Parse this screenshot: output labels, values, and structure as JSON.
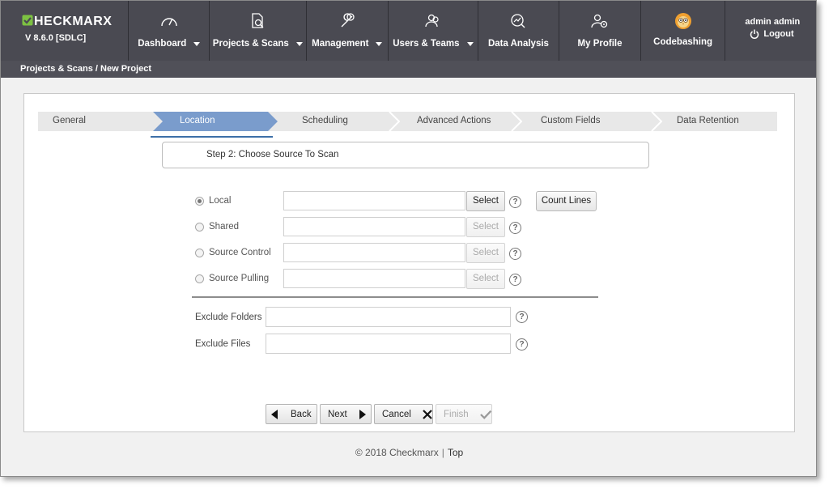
{
  "app": {
    "brand": "CHECKMARX",
    "version": "V 8.6.0  [SDLC]"
  },
  "nav": {
    "items": [
      {
        "label": "Dashboard",
        "icon": "gauge-icon",
        "dropdown": true
      },
      {
        "label": "Projects & Scans",
        "icon": "document-search-icon",
        "dropdown": true
      },
      {
        "label": "Management",
        "icon": "wrench-icon",
        "dropdown": true
      },
      {
        "label": "Users & Teams",
        "icon": "users-icon",
        "dropdown": true
      },
      {
        "label": "Data Analysis",
        "icon": "analysis-icon",
        "dropdown": false
      },
      {
        "label": "My Profile",
        "icon": "user-gear-icon",
        "dropdown": false
      },
      {
        "label": "Codebashing",
        "icon": "owl-avatar-icon",
        "dropdown": false
      }
    ],
    "user_name": "admin admin",
    "logout": "Logout"
  },
  "breadcrumb": "Projects & Scans / New Project",
  "wizard": {
    "steps": [
      "General",
      "Location",
      "Scheduling",
      "Advanced Actions",
      "Custom Fields",
      "Data Retention"
    ],
    "active_step": "Location",
    "step_title": "Step 2: Choose Source To Scan"
  },
  "source": {
    "options": [
      {
        "label": "Local",
        "selected": true,
        "value": "",
        "button": "Select",
        "button_enabled": true
      },
      {
        "label": "Shared",
        "selected": false,
        "value": "",
        "button": "Select",
        "button_enabled": false
      },
      {
        "label": "Source Control",
        "selected": false,
        "value": "",
        "button": "Select",
        "button_enabled": false
      },
      {
        "label": "Source Pulling",
        "selected": false,
        "value": "",
        "button": "Select",
        "button_enabled": false
      }
    ],
    "count_lines": "Count Lines",
    "help": "?"
  },
  "exclude": {
    "folders_label": "Exclude Folders",
    "folders_value": "",
    "files_label": "Exclude Files",
    "files_value": ""
  },
  "buttons": {
    "back": "Back",
    "next": "Next",
    "cancel": "Cancel",
    "finish": "Finish"
  },
  "footer": {
    "copyright": "© 2018 Checkmarx",
    "separator": "|",
    "top_link": "Top"
  },
  "colors": {
    "topbar": "#4a4a52",
    "accent_green": "#7dc242",
    "active_step": "#7a9ccc",
    "step_underline": "#3d6fa8"
  }
}
